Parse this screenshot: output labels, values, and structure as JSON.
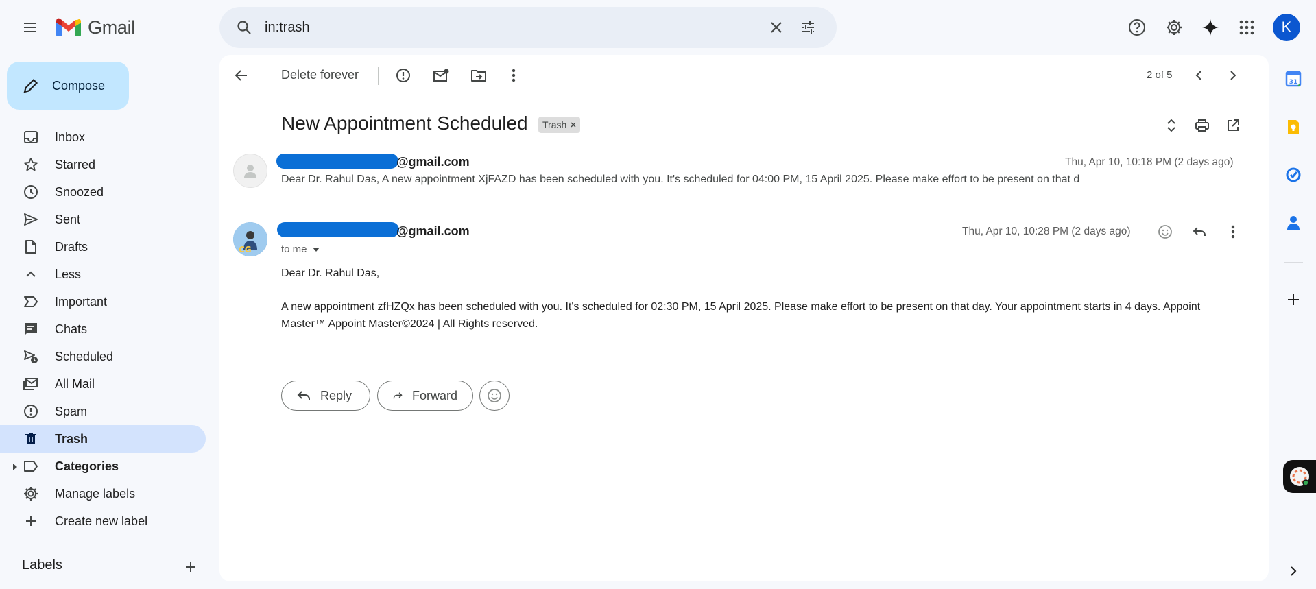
{
  "app": {
    "logo_text": "Gmail"
  },
  "search": {
    "query": "in:trash"
  },
  "account": {
    "initial": "K"
  },
  "compose": {
    "label": "Compose"
  },
  "sidebar": {
    "items": [
      {
        "label": "Inbox",
        "icon": "inbox-icon"
      },
      {
        "label": "Starred",
        "icon": "star-icon"
      },
      {
        "label": "Snoozed",
        "icon": "clock-icon"
      },
      {
        "label": "Sent",
        "icon": "send-icon"
      },
      {
        "label": "Drafts",
        "icon": "draft-icon"
      },
      {
        "label": "Less",
        "icon": "chevron-up-icon"
      },
      {
        "label": "Important",
        "icon": "important-icon"
      },
      {
        "label": "Chats",
        "icon": "chat-icon"
      },
      {
        "label": "Scheduled",
        "icon": "scheduled-icon"
      },
      {
        "label": "All Mail",
        "icon": "all-mail-icon"
      },
      {
        "label": "Spam",
        "icon": "spam-icon"
      },
      {
        "label": "Trash",
        "icon": "trash-icon"
      },
      {
        "label": "Categories",
        "icon": "label-icon"
      },
      {
        "label": "Manage labels",
        "icon": "gear-icon"
      },
      {
        "label": "Create new label",
        "icon": "plus-icon"
      }
    ],
    "labels_heading": "Labels"
  },
  "toolbar": {
    "delete_forever": "Delete forever",
    "pager": "2 of 5"
  },
  "thread": {
    "subject": "New Appointment Scheduled",
    "label_chip": "Trash",
    "messages": [
      {
        "sender_suffix": "@gmail.com",
        "date": "Thu, Apr 10, 10:18 PM (2 days ago)",
        "snippet": "Dear Dr. Rahul Das, A new appointment XjFAZD has been scheduled with you. It's scheduled for 04:00 PM, 15 April 2025. Please make effort to be present on that d"
      },
      {
        "sender_suffix": "@gmail.com",
        "date": "Thu, Apr 10, 10:28 PM (2 days ago)",
        "to": "to me",
        "greeting": "Dear Dr. Rahul Das,",
        "body_line1": "A new appointment zfHZQx has been scheduled with you. It's scheduled for 02:30 PM, 15 April 2025. Please make effort to be present on that day. Your appointment starts in 4 days. Appoint",
        "body_line2": "Master™ Appoint Master©2024 | All Rights reserved."
      }
    ],
    "reply_label": "Reply",
    "forward_label": "Forward"
  },
  "colors": {
    "accent": "#0b57d0",
    "compose_bg": "#c2e7ff",
    "active_nav": "#d3e3fd",
    "redaction": "#0b6fd6"
  }
}
